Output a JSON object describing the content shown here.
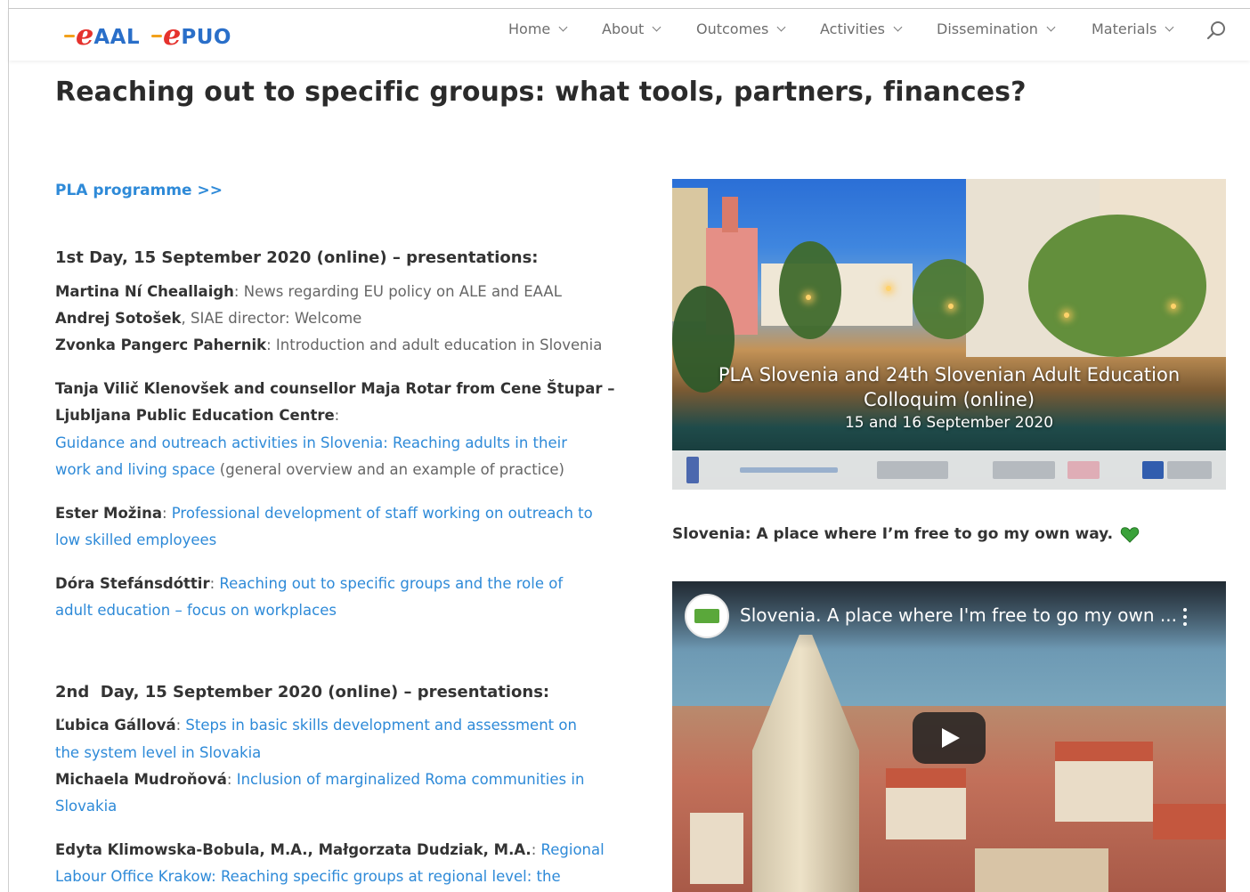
{
  "header": {
    "logo_left": {
      "swash": "e",
      "rest": "AAL",
      "colors": {
        "swash": "#e5322d",
        "rest": "#2a6fc9",
        "dash": "#f2a11b"
      }
    },
    "logo_right": {
      "swash": "e",
      "rest": "PUO",
      "colors": {
        "swash": "#e5322d",
        "rest": "#2a6fc9",
        "dash": "#f2a11b"
      }
    },
    "nav": [
      "Home",
      "About",
      "Outcomes",
      "Activities",
      "Dissemination",
      "Materials"
    ],
    "search_icon": "search-icon"
  },
  "page_title": "Reaching out to specific groups: what tools, partners, finances?",
  "content": {
    "pla_link": "PLA programme >>",
    "day1_heading": "1st Day, 15 September 2020 (online) – presentations:",
    "day1": {
      "p1_name": "Martina Ní Cheallaigh",
      "p1_text": ": News regarding EU policy on ALE and EAAL",
      "p2_name": "Andrej Sotošek",
      "p2_text": ", SIAE director: Welcome",
      "p3_name": "Zvonka Pangerc Pahernik",
      "p3_text": ": Introduction and adult education in Slovenia",
      "p4_name_line1": "Tanja Vilič Klenovšek and counsellor Maja Rotar from Cene Štupar –",
      "p4_name_line2": "Ljubljana Public Education Centre",
      "p4_colon": ":",
      "p4_link_line1": "Guidance and outreach activities in Slovenia: Reaching adults in their",
      "p4_link_line2": "work and living space",
      "p4_tail": " (general overview and an example of practice)",
      "p5_name": "Ester Možina",
      "p5_colon": ": ",
      "p5_link_line1": "Professional development of staff working on outreach to",
      "p5_link_line2": "low skilled employees",
      "p6_name": "Dóra Stefánsdóttir",
      "p6_colon": ": ",
      "p6_link_line1": "Reaching out to specific groups and the role of",
      "p6_link_line2": "adult education – focus on workplaces"
    },
    "day2_heading": "2nd  Day, 15 September 2020 (online) – presentations:",
    "day2": {
      "p1_name": "Ľubica Gállová",
      "p1_colon": ": ",
      "p1_link_line1": "Steps in basic skills development and assessment on",
      "p1_link_line2": "the system level in Slovakia",
      "p2_name": "Michaela Mudroňová",
      "p2_colon": ": ",
      "p2_link_line1": "Inclusion of marginalized Roma communities in",
      "p2_link_line2": "Slovakia",
      "p3_name": "Edyta Klimowska-Bobula, M.A., Małgorzata Dudziak, M.A.",
      "p3_colon": ": ",
      "p3_link_line1": "Regional",
      "p3_link_line2": "Labour Office Krakow: Reaching specific groups at regional level: the"
    }
  },
  "banner": {
    "line1": "PLA Slovenia and 24th Slovenian Adult Education",
    "line2": "Colloquim (online)",
    "line3": "15 and 16 September 2020"
  },
  "caption": "Slovenia: A place where I’m free to go my own way.",
  "caption_icon": "green-heart-icon",
  "video": {
    "title": "Slovenia. A place where I'm free to go my own ...",
    "play_icon": "play-icon",
    "menu_icon": "kebab-menu-icon"
  },
  "colors": {
    "link": "#2e8ad8",
    "heading": "#2b2b2b",
    "body": "#666666",
    "heart": "#3aa23a"
  }
}
